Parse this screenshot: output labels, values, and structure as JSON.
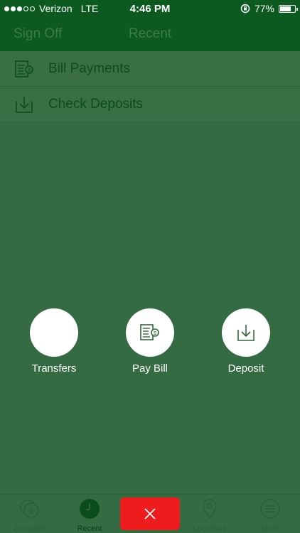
{
  "status_bar": {
    "carrier": "Verizon",
    "network": "LTE",
    "time": "4:46 PM",
    "battery": "77%",
    "battery_level": 0.77
  },
  "nav": {
    "sign_off": "Sign Off",
    "title": "Recent"
  },
  "menu": {
    "items": [
      {
        "label": "Bill Payments",
        "icon": "bill-icon"
      },
      {
        "label": "Check Deposits",
        "icon": "download-tray-icon"
      }
    ]
  },
  "actions": {
    "transfers": "Transfers",
    "pay_bill": "Pay Bill",
    "deposit": "Deposit"
  },
  "tabs": {
    "accounts": "Accounts",
    "recent": "Recent",
    "locations": "Locations",
    "more": "More"
  },
  "colors": {
    "brand_dark": "#0c5a1f",
    "background": "#356b42",
    "close_red": "#ee1c1c"
  }
}
